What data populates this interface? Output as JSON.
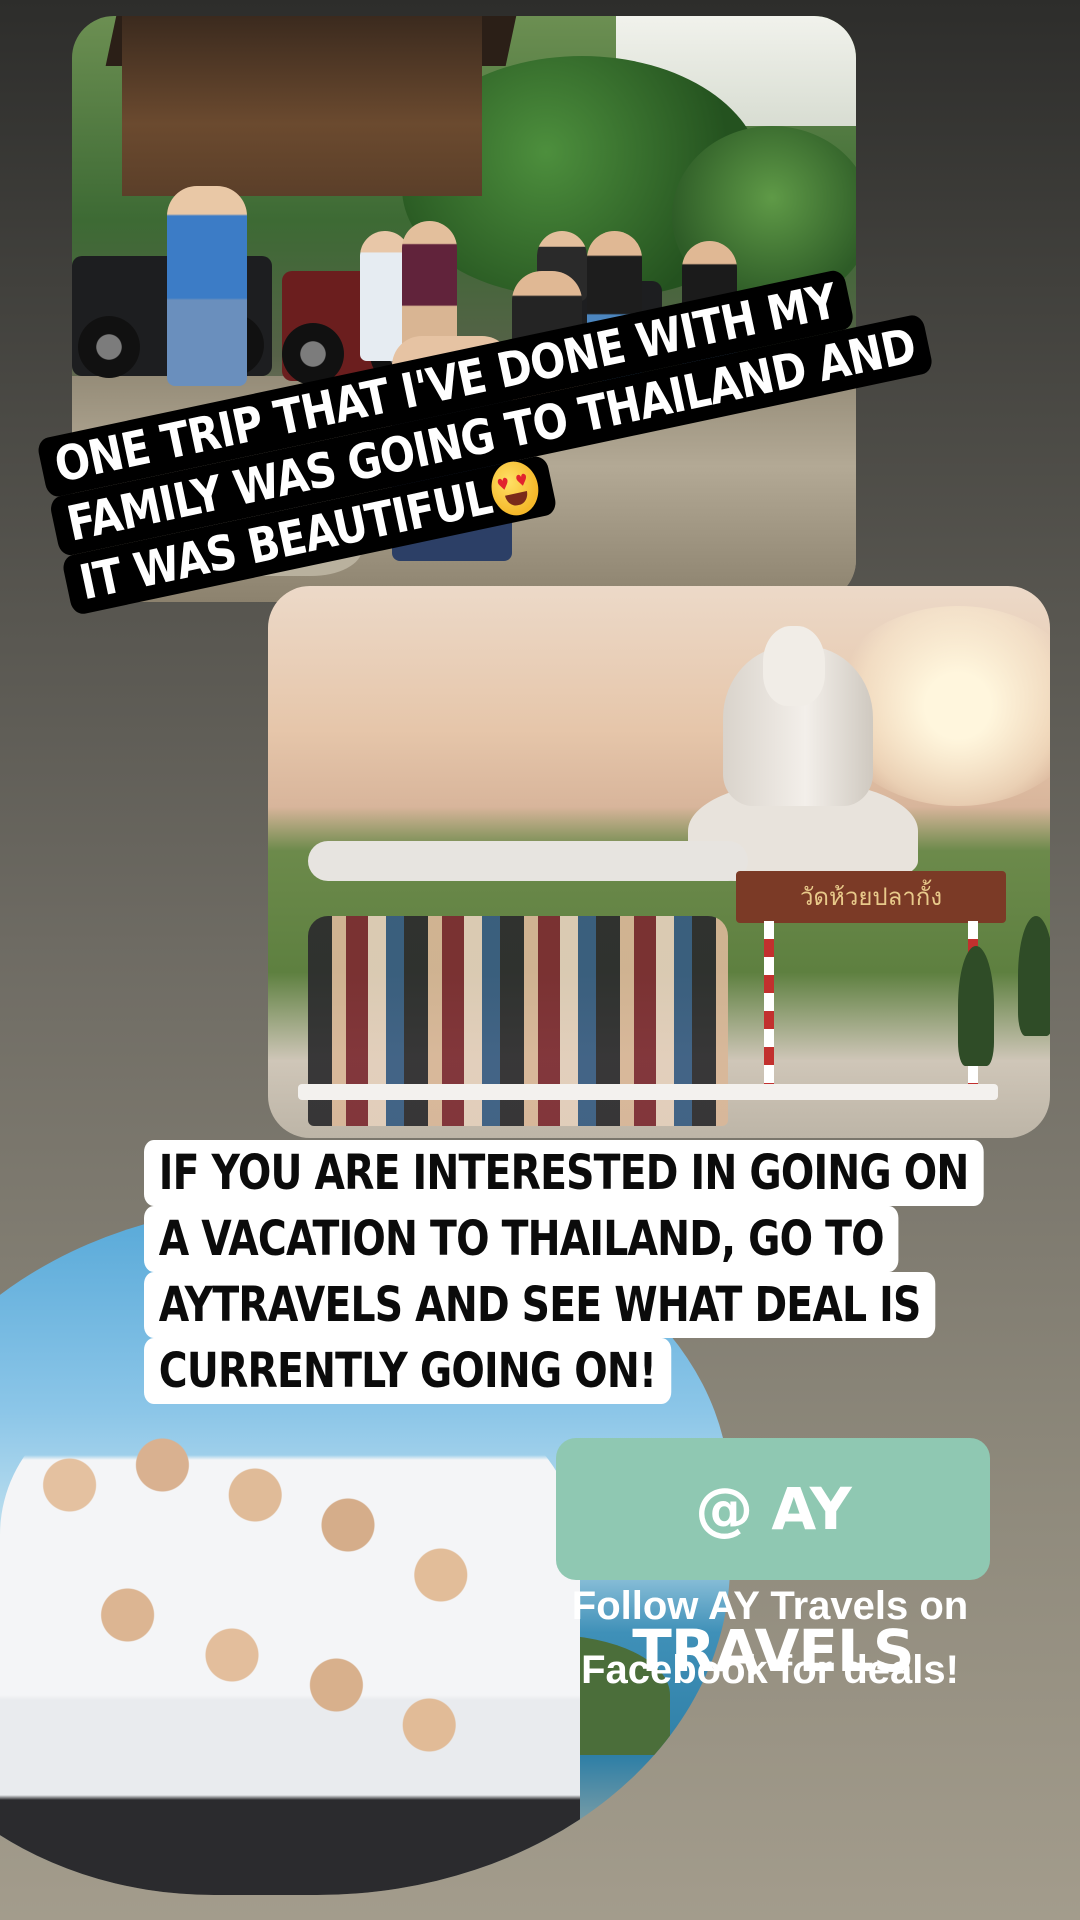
{
  "story": {
    "caption_top": {
      "lines": [
        "ONE TRIP THAT I'VE DONE WITH MY",
        "FAMILY WAS GOING TO THAILAND AND",
        "IT WAS BEAUTIFUL"
      ],
      "emoji": "heart-eyes-emoji"
    },
    "photos": {
      "atv_trip": {
        "icon": "photo"
      },
      "temple": {
        "sign_text": "วัดห้วยปลากั้ง"
      },
      "beach": {
        "icon": "photo"
      }
    },
    "caption_bottom": {
      "lines": [
        "IF YOU ARE INTERESTED IN GOING ON",
        "A VACATION TO THAILAND, GO TO",
        "AYTRAVELS AND SEE WHAT DEAL IS",
        "CURRENTLY GOING ON!"
      ]
    },
    "mention_sticker": {
      "label": "@ AY TRAVELS"
    },
    "follow_text": {
      "line1": "Follow AY Travels on",
      "line2": "Facebook for deals!"
    },
    "colors": {
      "mention_bg": "#8fc8b2",
      "caption_top_bg": "#000000",
      "caption_bottom_bg": "#ffffff"
    }
  }
}
